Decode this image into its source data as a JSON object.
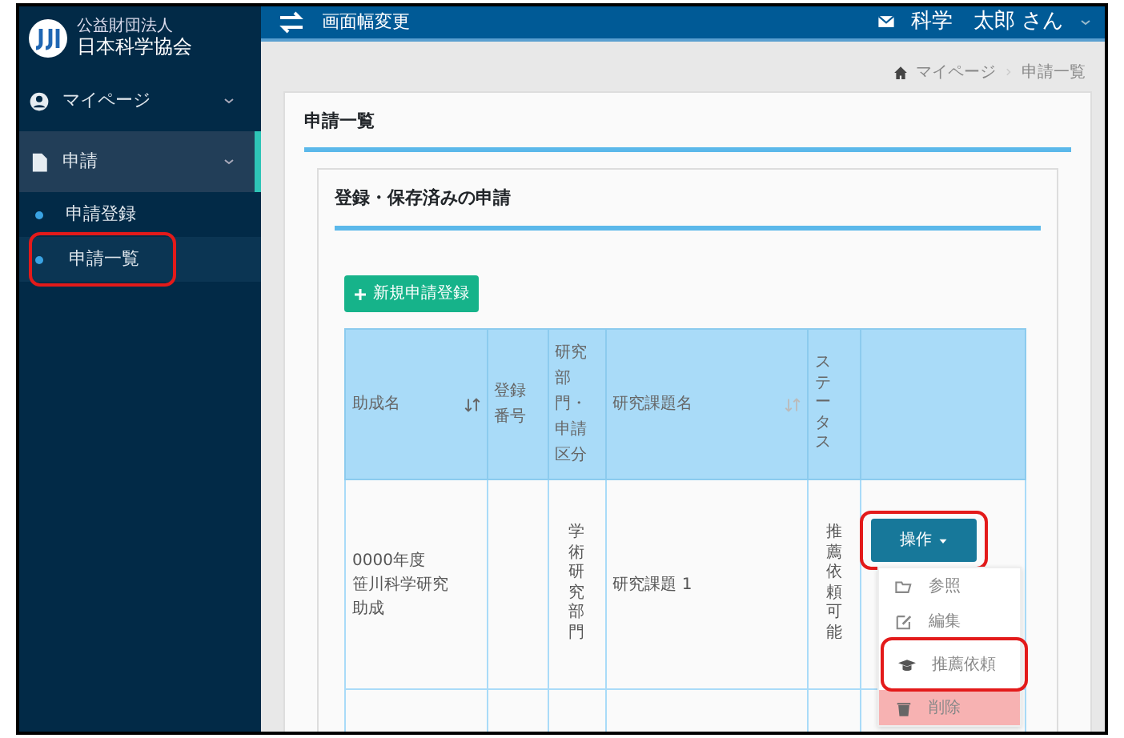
{
  "brand": {
    "org_type": "公益財団法人",
    "name": "日本科学協会"
  },
  "topbar": {
    "toggle_label": "画面幅変更",
    "user_name": "科学　太郎 さん"
  },
  "sidebar": {
    "items": [
      {
        "label": "マイページ",
        "kind": "user",
        "expanded": false
      },
      {
        "label": "申請",
        "kind": "document",
        "expanded": true,
        "children": [
          {
            "label": "申請登録",
            "selected": false,
            "annotated": false
          },
          {
            "label": "申請一覧",
            "selected": true,
            "annotated": true
          }
        ]
      }
    ]
  },
  "breadcrumb": [
    "マイページ",
    "申請一覧"
  ],
  "panel": {
    "title": "申請一覧",
    "section_title": "登録・保存済みの申請",
    "new_button": "新規申請登録",
    "table": {
      "columns": [
        {
          "label": "助成名",
          "kind": "wide",
          "sortable": true,
          "sorted": true
        },
        {
          "label": "登録番号",
          "kind": "narrow"
        },
        {
          "label": "研究部門・申請区分",
          "kind": "narrow"
        },
        {
          "label": "研究課題名",
          "kind": "wide",
          "sortable": true,
          "sorted": false
        },
        {
          "label": "ステータス",
          "kind": "vertical"
        },
        {
          "kind": "actions"
        }
      ],
      "rows": [
        {
          "grant_lines": [
            "0000年度",
            "笹川科学研究",
            "助成"
          ],
          "division": "学術研究部門",
          "topic": "研究課題 1",
          "status": "推薦依頼可能",
          "action": {
            "label": "操作",
            "annotated": true,
            "expanded": true,
            "menu": [
              {
                "label": "参照",
                "kind": "view",
                "annotated": false
              },
              {
                "label": "編集",
                "kind": "edit",
                "annotated": false
              },
              {
                "label": "推薦依頼",
                "kind": "recommend",
                "annotated": true
              },
              {
                "label": "削除",
                "kind": "delete",
                "annotated": false
              }
            ]
          }
        }
      ]
    }
  }
}
